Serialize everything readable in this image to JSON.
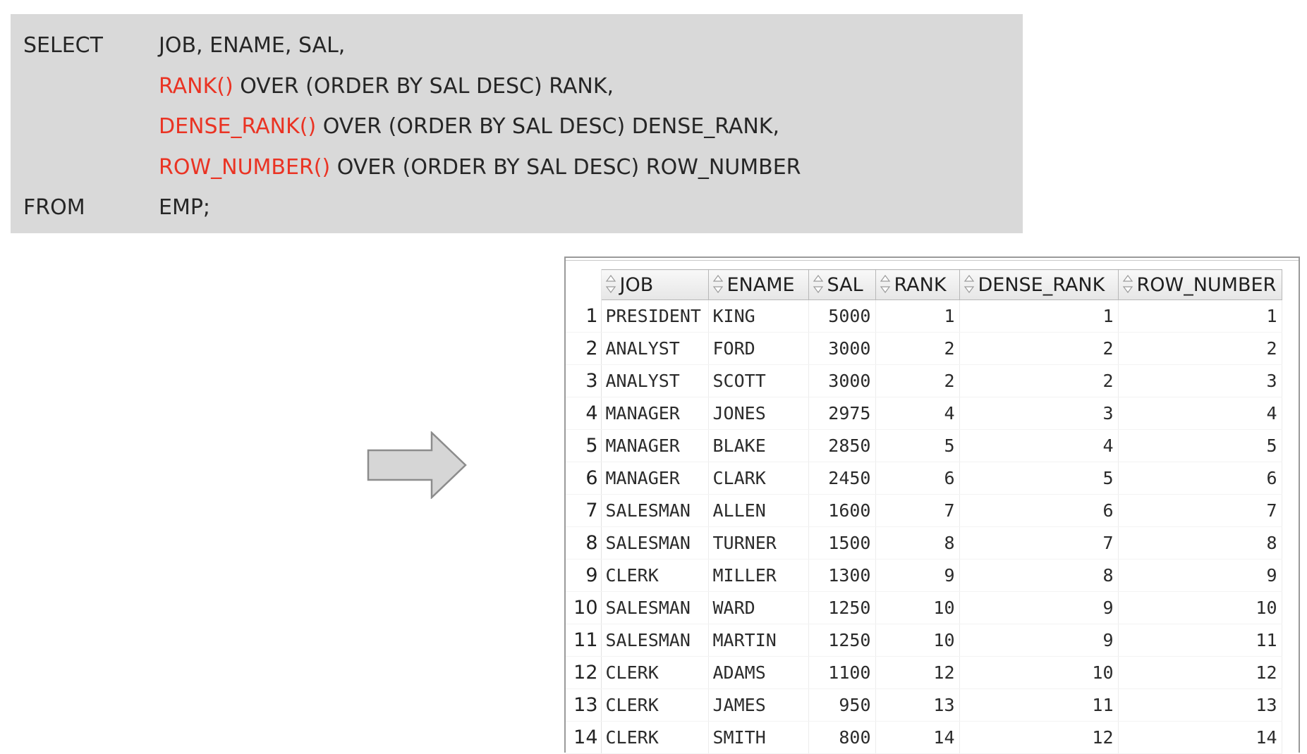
{
  "sql": {
    "lines": [
      {
        "keyword": "SELECT",
        "func": "",
        "rest": "JOB, ENAME, SAL,"
      },
      {
        "keyword": "",
        "func": "RANK()",
        "rest": " OVER (ORDER BY SAL DESC) RANK,"
      },
      {
        "keyword": "",
        "func": "DENSE_RANK()",
        "rest": " OVER (ORDER BY SAL DESC) DENSE_RANK,"
      },
      {
        "keyword": "",
        "func": "ROW_NUMBER()",
        "rest": " OVER (ORDER BY SAL DESC) ROW_NUMBER"
      },
      {
        "keyword": "FROM",
        "func": "",
        "rest": "EMP;"
      }
    ]
  },
  "colors": {
    "function_highlight": "#ea3323",
    "sql_background": "#d9d9d9"
  },
  "arrow_icon": "right-arrow-icon",
  "result": {
    "columns": [
      "JOB",
      "ENAME",
      "SAL",
      "RANK",
      "DENSE_RANK",
      "ROW_NUMBER"
    ],
    "rows": [
      [
        "1",
        "PRESIDENT",
        "KING",
        "5000",
        "1",
        "1",
        "1"
      ],
      [
        "2",
        "ANALYST",
        "FORD",
        "3000",
        "2",
        "2",
        "2"
      ],
      [
        "3",
        "ANALYST",
        "SCOTT",
        "3000",
        "2",
        "2",
        "3"
      ],
      [
        "4",
        "MANAGER",
        "JONES",
        "2975",
        "4",
        "3",
        "4"
      ],
      [
        "5",
        "MANAGER",
        "BLAKE",
        "2850",
        "5",
        "4",
        "5"
      ],
      [
        "6",
        "MANAGER",
        "CLARK",
        "2450",
        "6",
        "5",
        "6"
      ],
      [
        "7",
        "SALESMAN",
        "ALLEN",
        "1600",
        "7",
        "6",
        "7"
      ],
      [
        "8",
        "SALESMAN",
        "TURNER",
        "1500",
        "8",
        "7",
        "8"
      ],
      [
        "9",
        "CLERK",
        "MILLER",
        "1300",
        "9",
        "8",
        "9"
      ],
      [
        "10",
        "SALESMAN",
        "WARD",
        "1250",
        "10",
        "9",
        "10"
      ],
      [
        "11",
        "SALESMAN",
        "MARTIN",
        "1250",
        "10",
        "9",
        "11"
      ],
      [
        "12",
        "CLERK",
        "ADAMS",
        "1100",
        "12",
        "10",
        "12"
      ],
      [
        "13",
        "CLERK",
        "JAMES",
        "950",
        "13",
        "11",
        "13"
      ],
      [
        "14",
        "CLERK",
        "SMITH",
        "800",
        "14",
        "12",
        "14"
      ]
    ]
  }
}
